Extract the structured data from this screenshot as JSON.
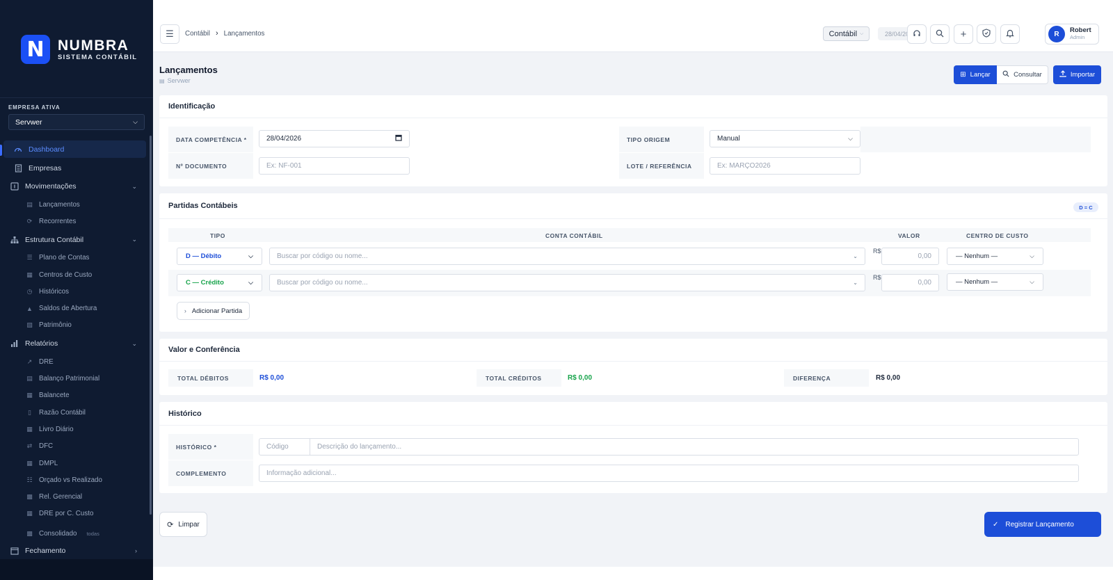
{
  "sidebar": {
    "logo": {
      "mark": "N",
      "name": "NUMBRA",
      "subtitle": "SISTEMA CONTÁBIL"
    },
    "empresa_label": "EMPRESA ATIVA",
    "empresa_value": "Servwer",
    "dashboard": "Dashboard",
    "empresas": "Empresas",
    "movimentacoes": {
      "label": "Movimentações",
      "items": [
        "Lançamentos",
        "Recorrentes"
      ]
    },
    "estrutura": {
      "label": "Estrutura Contábil",
      "items": [
        "Plano de Contas",
        "Centros de Custo",
        "Históricos",
        "Saldos de Abertura",
        "Patrimônio"
      ]
    },
    "relatorios": {
      "label": "Relatórios",
      "items": [
        "DRE",
        "Balanço Patrimonial",
        "Balancete",
        "Razão Contábil",
        "Livro Diário",
        "DFC",
        "DMPL",
        "Orçado vs Realizado",
        "Rel. Gerencial",
        "DRE por C. Custo",
        "Consolidado"
      ],
      "consolidado_tag": "todas"
    },
    "fechamento": "Fechamento"
  },
  "topbar": {
    "breadcrumb": [
      "Contábil",
      "Lançamentos"
    ],
    "module": "Contábil",
    "date": "28/04/2026",
    "user": {
      "initial": "R",
      "name": "Robert",
      "role": "Admin"
    }
  },
  "page": {
    "title": "Lançamentos",
    "subtitle": "Servwer",
    "actions": {
      "lancar": "Lançar",
      "consultar": "Consultar",
      "importar": "Importar"
    }
  },
  "identificacao": {
    "title": "Identificação",
    "data_competencia_label": "DATA COMPETÊNCIA *",
    "data_competencia_value": "28/04/2026",
    "tipo_origem_label": "TIPO ORIGEM",
    "tipo_origem_value": "Manual",
    "documento_label": "Nº DOCUMENTO",
    "documento_placeholder": "Ex: NF-001",
    "lote_label": "LOTE / REFERÊNCIA",
    "lote_placeholder": "Ex: MARÇO2026"
  },
  "partidas": {
    "title": "Partidas Contábeis",
    "badge": "D = C",
    "headers": {
      "tipo": "TIPO",
      "conta": "CONTA CONTÁBIL",
      "valor": "VALOR",
      "centro": "CENTRO DE CUSTO"
    },
    "rows": [
      {
        "tipo": "D — Débito",
        "conta_placeholder": "Buscar por código ou nome...",
        "currency": "R$",
        "valor": "0,00",
        "centro": "— Nenhum —",
        "color": "#1d4ed8"
      },
      {
        "tipo": "C — Crédito",
        "conta_placeholder": "Buscar por código ou nome...",
        "currency": "R$",
        "valor": "0,00",
        "centro": "— Nenhum —",
        "color": "#16a34a"
      }
    ],
    "add_button": "Adicionar Partida"
  },
  "conferencia": {
    "title": "Valor e Conferência",
    "total_debitos_label": "TOTAL DÉBITOS",
    "total_debitos_value": "R$ 0,00",
    "total_creditos_label": "TOTAL CRÉDITOS",
    "total_creditos_value": "R$ 0,00",
    "diferenca_label": "DIFERENÇA",
    "diferenca_value": "R$ 0,00"
  },
  "historico": {
    "title": "Histórico",
    "historico_label": "HISTÓRICO *",
    "codigo_placeholder": "Código",
    "descricao_placeholder": "Descrição do lançamento...",
    "complemento_label": "COMPLEMENTO",
    "complemento_placeholder": "Informação adicional..."
  },
  "footer": {
    "limpar": "Limpar",
    "registrar": "Registrar Lançamento"
  },
  "colors": {
    "sidebar_bg": "#0f1b31",
    "primary": "#1d4ed8",
    "debit": "#1d4ed8",
    "credit": "#16a34a"
  }
}
